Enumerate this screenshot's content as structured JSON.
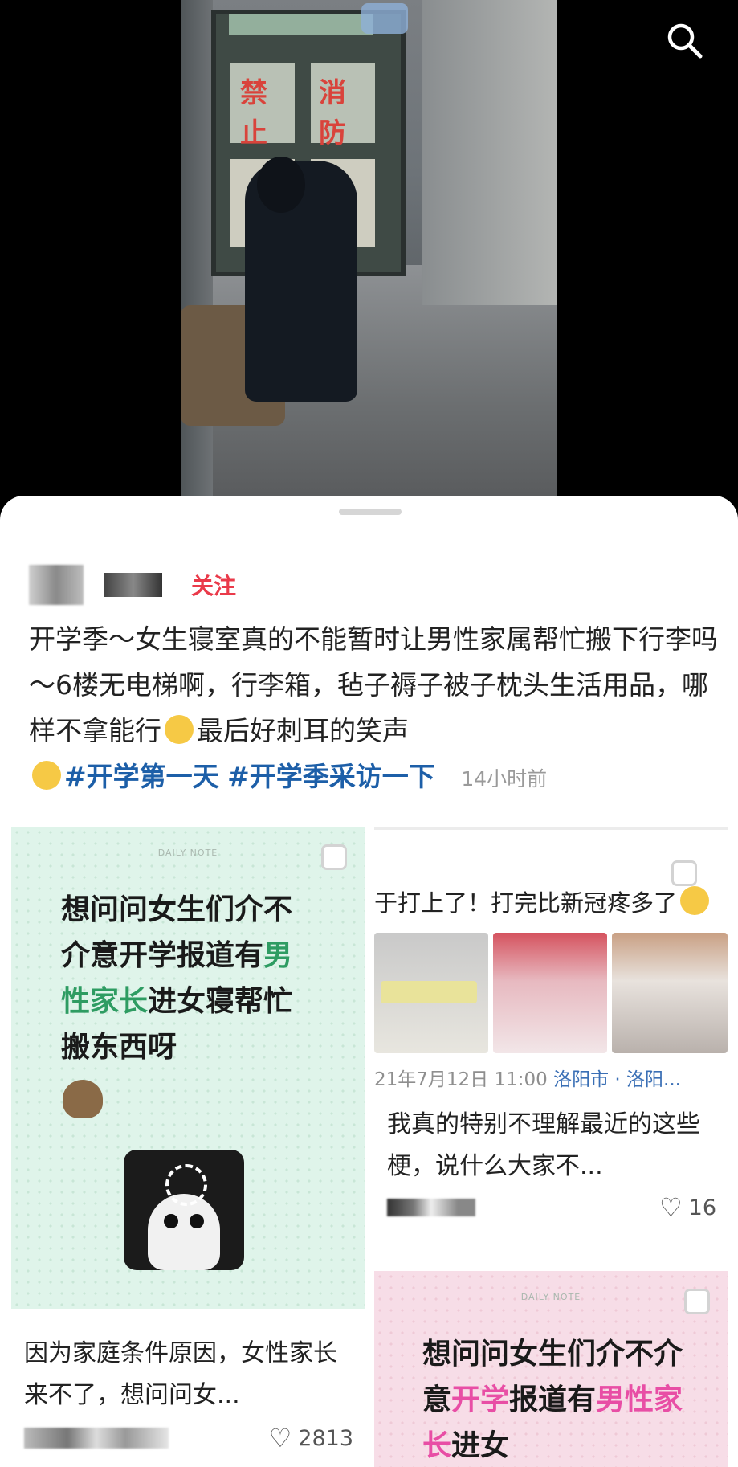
{
  "header": {
    "search_icon": "search-icon"
  },
  "post": {
    "follow_label": "关注",
    "text_body": "开学季～女生寝室真的不能暂时让男性家属帮忙搬下行李吗～6楼无电梯啊，行李箱，毡子褥子被子枕头生活用品，哪样不拿能行",
    "text_tail": "最后好刺耳的笑声",
    "tags": [
      "#开学第一天",
      "#开学季采访一下"
    ],
    "time": "14小时前"
  },
  "cards": {
    "left": {
      "daily": "DAILY NOTE",
      "title_1": "想问问女生们介不介意开学报道有",
      "title_highlight": "男性家长",
      "title_2": "进女寝帮忙搬东西呀",
      "text": "因为家庭条件原因，女性家长来不了，想问问女...",
      "likes": "2813"
    },
    "right": {
      "title": "于打上了！打完比新冠疼多了",
      "meta_date": "21年7月12日 11:00",
      "meta_loc": "洛阳市 · 洛阳...",
      "text": "我真的特别不理解最近的这些梗，说什么大家不...",
      "likes": "16"
    },
    "right2": {
      "daily": "DAILY NOTE",
      "title_1": "想问问女生们介不介意",
      "title_pink_1": "开学",
      "title_2": "报道有",
      "title_pink_2": "男性家长",
      "title_3": "进女"
    }
  }
}
